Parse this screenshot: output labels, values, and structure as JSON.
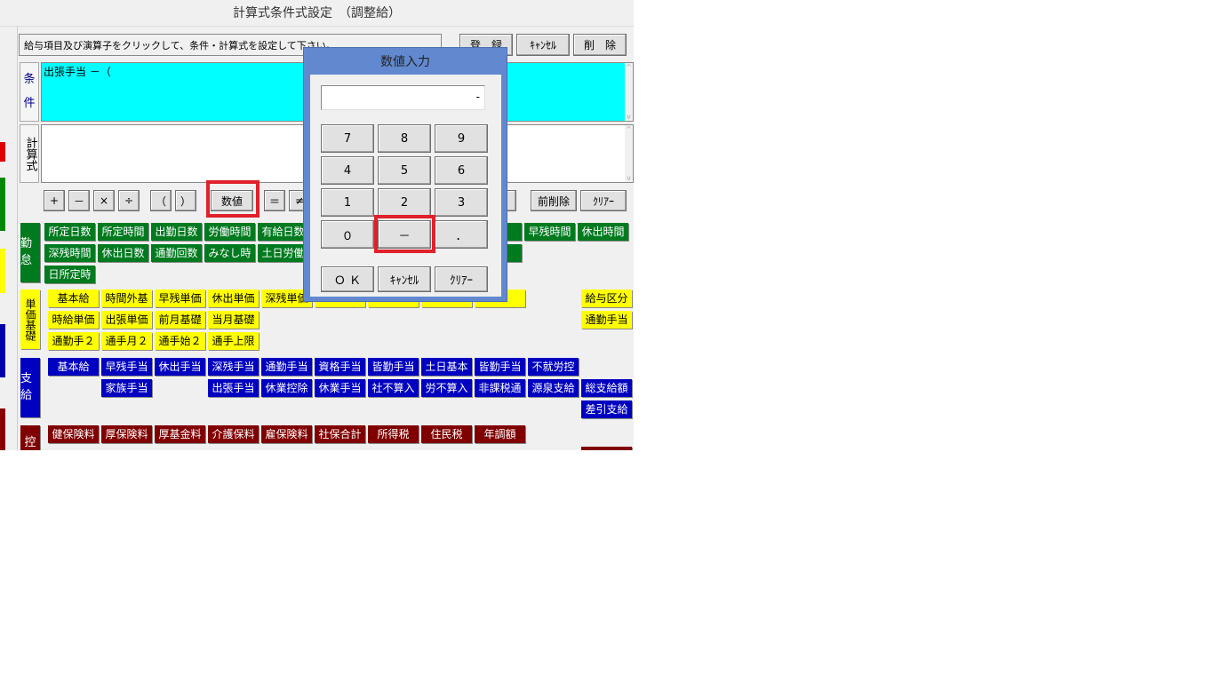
{
  "window": {
    "title": "計算式条件式設定　（調整給）"
  },
  "instruction": "給与項目及び演算子をクリックして、条件・計算式を設定して下さい。",
  "toolbar": {
    "register": "登　録",
    "cancel": "ｷｬﾝｾﾙ",
    "delete": "削　除"
  },
  "condition": {
    "label": [
      "条",
      "件"
    ],
    "value": "出張手当 －（",
    "bg": "#00ffff"
  },
  "formula": {
    "label": "計算式",
    "value": ""
  },
  "operators": {
    "plus": "+",
    "minus": "－",
    "times": "×",
    "divide": "÷",
    "lparen": "（",
    "rparen": "）",
    "number": "数値",
    "equal": "＝",
    "notequal": "≠",
    "backspace": "前削除",
    "clear": "ｸﾘｱｰ"
  },
  "categories": [
    {
      "label": "勤怠",
      "color": "#007a1f",
      "text": "#ffffff",
      "rows": [
        [
          "所定日数",
          "所定時間",
          "出勤日数",
          "労働時間",
          "有給日数",
          "",
          "",
          "",
          "",
          "早残時間",
          "休出時間"
        ],
        [
          "深残時間",
          "休出日数",
          "通勤回数",
          "みなし時",
          "土日労働",
          "",
          "",
          "",
          "",
          null,
          null
        ],
        [
          "日所定時"
        ]
      ]
    },
    {
      "label": "単価基礎",
      "color": "#ffff00",
      "text": "#000000",
      "rows": [
        [
          "基本給",
          "時間外基",
          "早残単価",
          "休出単価",
          "深残単価",
          "",
          "",
          "",
          "",
          null,
          "給与区分"
        ],
        [
          "時給単価",
          "出張単価",
          "前月基礎",
          "当月基礎",
          null,
          null,
          null,
          null,
          null,
          null,
          "通勤手当"
        ],
        [
          "通勤手２",
          "通手月２",
          "通手始２",
          "通手上限"
        ]
      ]
    },
    {
      "label": "支給",
      "color": "#0000c0",
      "text": "#ffffff",
      "rows": [
        [
          "基本給",
          "早残手当",
          "休出手当",
          "深残手当",
          "通勤手当",
          "資格手当",
          "皆勤手当",
          "土日基本",
          "皆勤手当",
          "不就労控",
          null
        ],
        [
          null,
          "家族手当",
          null,
          "出張手当",
          "休業控除",
          "休業手当",
          "社不算入",
          "労不算入",
          "非課税通",
          "源泉支給",
          "総支給額"
        ],
        [
          null,
          null,
          null,
          null,
          null,
          null,
          null,
          null,
          null,
          null,
          "差引支給"
        ]
      ]
    },
    {
      "label": "控",
      "color": "#800000",
      "text": "#ffffff",
      "rows": [
        [
          "健保険料",
          "厚保険料",
          "厚基金料",
          "介護保料",
          "雇保険料",
          "社保合計",
          "所得税",
          "住民税",
          "年調額",
          null,
          null
        ],
        [
          null,
          null,
          null,
          null,
          null,
          null,
          null,
          null,
          null,
          null,
          ""
        ]
      ]
    }
  ],
  "dialog": {
    "title": "数値入力",
    "display": "-",
    "keys": [
      [
        "7",
        "8",
        "9"
      ],
      [
        "4",
        "5",
        "6"
      ],
      [
        "1",
        "2",
        "3"
      ],
      [
        "０",
        "－",
        "．"
      ]
    ],
    "ok": "Ｏ Ｋ",
    "cancel": "ｷｬﾝｾﾙ",
    "clear": "ｸﾘｱｰ"
  },
  "highlight_color": "#e0202a"
}
